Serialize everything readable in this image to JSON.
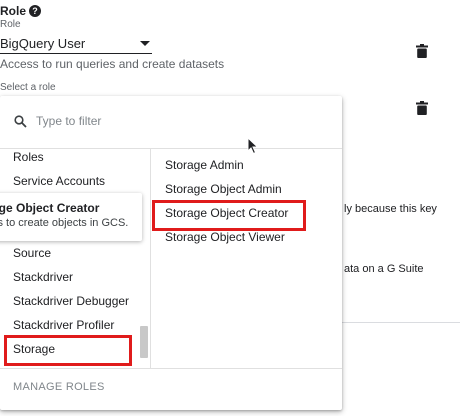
{
  "role_section": {
    "heading": "Role",
    "field_label": "Role",
    "selected_value": "BigQuery User",
    "description": "Access to run queries and create datasets",
    "select_label": "Select a role"
  },
  "background": {
    "note_1": "ly because this key",
    "note_2": "ata on a G Suite"
  },
  "dropdown": {
    "filter_placeholder": "Type to filter",
    "categories": [
      "Roles",
      "Service Accounts",
      "Source",
      "Stackdriver",
      "Stackdriver Debugger",
      "Stackdriver Profiler",
      "Storage"
    ],
    "selected_category": "Storage",
    "roles": [
      "Storage Admin",
      "Storage Object Admin",
      "Storage Object Creator",
      "Storage Object Viewer"
    ],
    "selected_role": "Storage Object Creator",
    "manage_label": "MANAGE ROLES"
  },
  "tooltip": {
    "title": "age Object Creator",
    "description": "ss to create objects in GCS."
  },
  "icons": [
    "help-icon",
    "chevron-down-icon",
    "trash-icon",
    "search-icon",
    "mouse-cursor-icon"
  ],
  "colors": {
    "highlight": "#e01b1b",
    "text": "#202124",
    "muted": "#5f6368"
  }
}
